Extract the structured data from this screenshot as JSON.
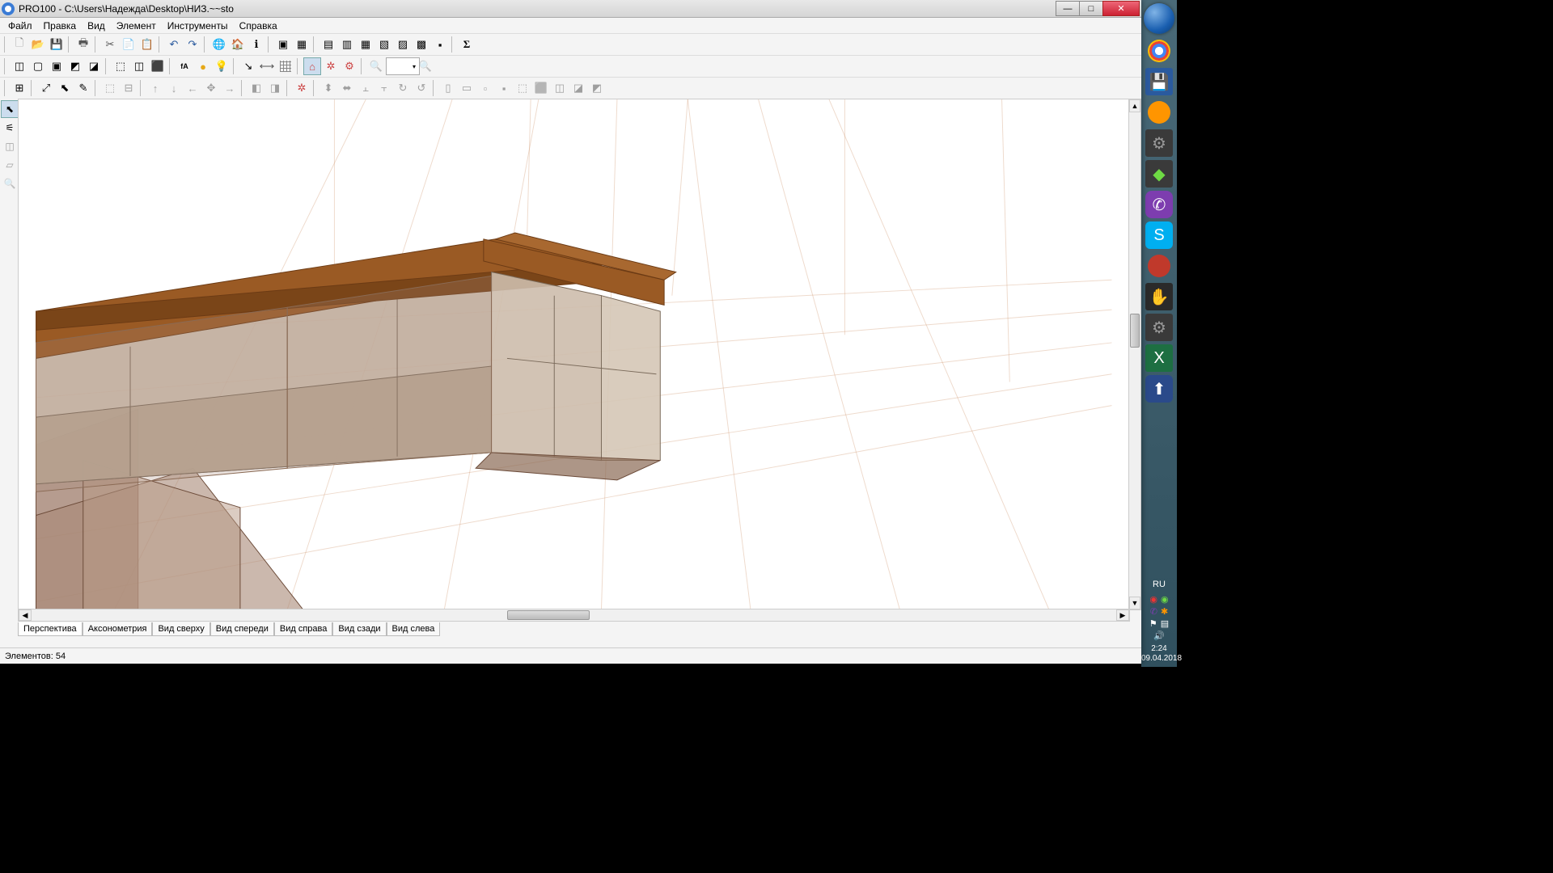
{
  "window": {
    "title": "PRO100 - C:\\Users\\Надежда\\Desktop\\НИЗ.~~sto",
    "controls": {
      "min": "—",
      "max": "□",
      "close": "✕"
    }
  },
  "menu": {
    "items": [
      {
        "label": "Файл"
      },
      {
        "label": "Правка"
      },
      {
        "label": "Вид"
      },
      {
        "label": "Элемент"
      },
      {
        "label": "Инструменты"
      },
      {
        "label": "Справка"
      }
    ]
  },
  "view_tabs": [
    {
      "label": "Перспектива",
      "active": true
    },
    {
      "label": "Аксонометрия"
    },
    {
      "label": "Вид сверху"
    },
    {
      "label": "Вид спереди"
    },
    {
      "label": "Вид справа"
    },
    {
      "label": "Вид сзади"
    },
    {
      "label": "Вид слева"
    }
  ],
  "status": {
    "elements_label": "Элементов:",
    "elements_count": "54"
  },
  "tray": {
    "lang": "RU",
    "time": "2:24",
    "date": "09.04.2018"
  }
}
